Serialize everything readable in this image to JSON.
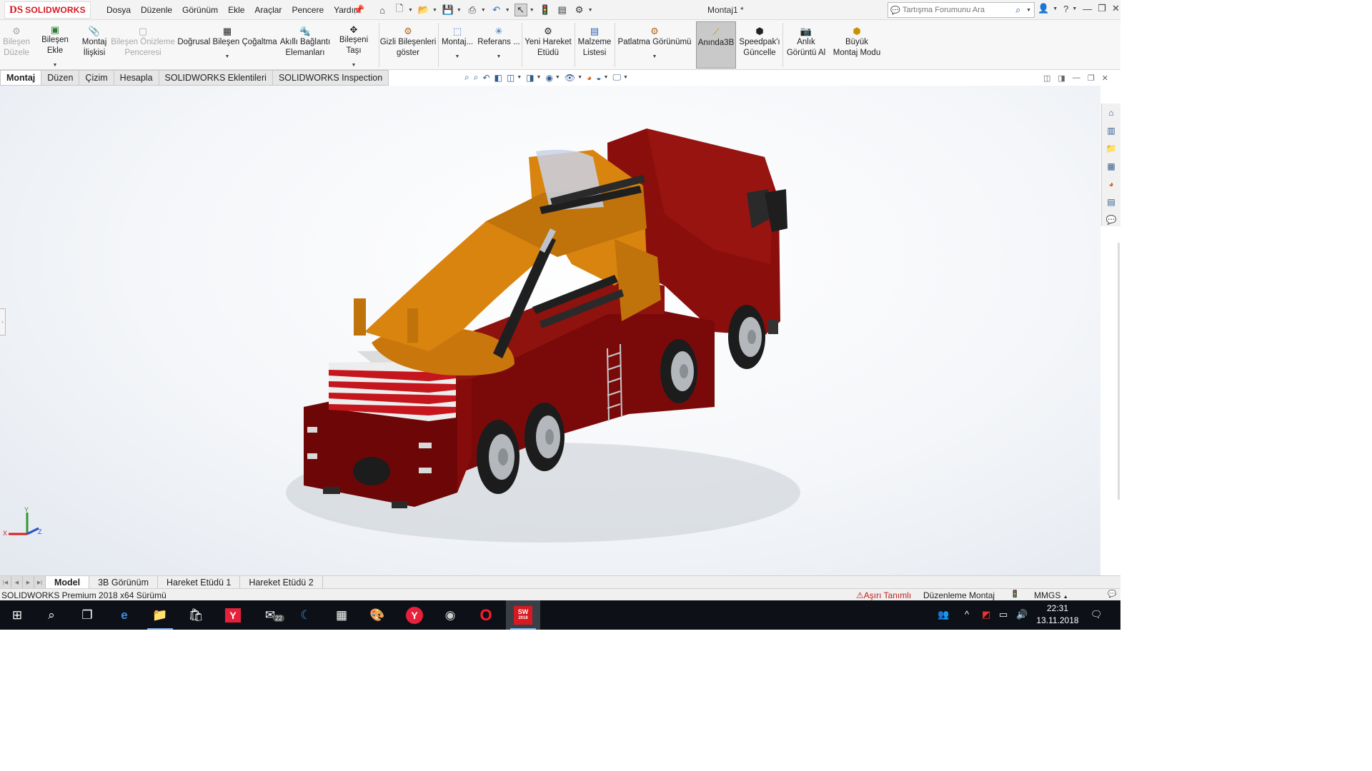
{
  "title_bar": {
    "logo_ds": "DS",
    "logo_text": "SOLIDWORKS",
    "menu": [
      "Dosya",
      "Düzenle",
      "Görünüm",
      "Ekle",
      "Araçlar",
      "Pencere",
      "Yardım"
    ],
    "document_title": "Montaj1 *",
    "search_placeholder": "Tartışma Forumunu Ara"
  },
  "ribbon": [
    {
      "label": "Bileşen\nDüzele",
      "disabled": true,
      "icon": "edit-component-icon"
    },
    {
      "label": "Bileşen Ekle",
      "caret": true,
      "icon": "insert-component-icon"
    },
    {
      "label": "Montaj\nİlişkisi",
      "icon": "mate-icon"
    },
    {
      "label": "Bileşen Önizleme\nPenceresi",
      "disabled": true,
      "icon": "preview-window-icon"
    },
    {
      "label": "Doğrusal Bileşen Çoğaltma",
      "caret": true,
      "icon": "linear-pattern-icon"
    },
    {
      "label": "Akıllı Bağlantı\nElemanları",
      "icon": "smart-fasteners-icon"
    },
    {
      "label": "Bileşeni Taşı",
      "caret": true,
      "icon": "move-component-icon"
    },
    {
      "label": "Gizli Bileşenleri\ngöster",
      "icon": "show-hidden-icon"
    },
    {
      "label": "Montaj...",
      "caret": true,
      "icon": "assembly-features-icon"
    },
    {
      "label": "Referans ...",
      "caret": true,
      "icon": "reference-geometry-icon"
    },
    {
      "label": "Yeni Hareket\nEtüdü",
      "icon": "motion-study-icon"
    },
    {
      "label": "Malzeme\nListesi",
      "icon": "bom-icon"
    },
    {
      "label": "Patlatma Görünümü",
      "caret": true,
      "icon": "exploded-view-icon"
    },
    {
      "label": "Anında3B",
      "active": true,
      "icon": "instant3d-icon"
    },
    {
      "label": "Speedpak'ı\nGüncelle",
      "icon": "speedpak-icon"
    },
    {
      "label": "Anlık\nGörüntü Al",
      "icon": "snapshot-icon"
    },
    {
      "label": "Büyük\nMontaj Modu",
      "icon": "large-assembly-icon"
    }
  ],
  "command_tabs": [
    "Montaj",
    "Düzen",
    "Çizim",
    "Hesapla",
    "SOLIDWORKS Eklentileri",
    "SOLIDWORKS Inspection"
  ],
  "colors": {
    "truck_body": "#7a0a0a",
    "truck_body_light": "#9a1410",
    "crane": "#d9840f",
    "crane_dark": "#b86c0a",
    "hydraulic": "#1f1f1f",
    "chrome": "#bfc3c7",
    "stripe_red": "#c4161c",
    "brand_red": "#d71920"
  },
  "triad": {
    "x": "X",
    "y": "Y",
    "z": "Z"
  },
  "bottom_tabs": [
    "Model",
    "3B Görünüm",
    "Hareket Etüdü 1",
    "Hareket Etüdü 2"
  ],
  "status": {
    "version": "SOLIDWORKS Premium 2018 x64 Sürümü",
    "warning": "Aşırı Tanımlı",
    "mode": "Düzenleme Montaj",
    "units": "MMGS"
  },
  "taskbar": {
    "mail_badge": "22",
    "sw_label": "SW",
    "sw_year": "2018",
    "time": "22:31",
    "date": "13.11.2018"
  }
}
